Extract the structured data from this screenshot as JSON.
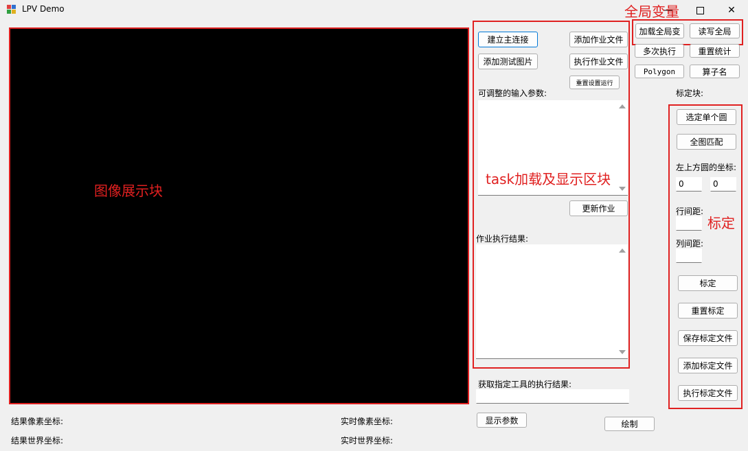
{
  "window": {
    "title": "LPV Demo",
    "minimize_icon": "minimize-icon",
    "maximize_icon": "maximize-icon",
    "close_icon": "close-icon"
  },
  "annotations": {
    "image_area": "图像展示块",
    "task_area": "task加载及显示区块",
    "global_vars": "全局变量",
    "calibration": "标定",
    "color": "#e02020"
  },
  "task_panel": {
    "connect_label": "建立主连接",
    "add_job_label": "添加作业文件",
    "add_test_image_label": "添加测试图片",
    "run_job_label": "执行作业文件",
    "reset_run_label": "重置设置运行",
    "params_label": "可调整的输入参数:",
    "update_job_label": "更新作业",
    "results_label": "作业执行结果:",
    "tool_result_label": "获取指定工具的执行结果:",
    "tool_result_value": "",
    "show_params_label": "显示参数",
    "draw_label": "绘制"
  },
  "global_panel": {
    "load_global_label": "加载全局变",
    "rw_global_label": "读写全局",
    "multi_run_label": "多次执行",
    "reset_stats_label": "重置统计",
    "polygon_label": "Polygon",
    "operator_name_label": "算子名",
    "calib_block_label": "标定块:"
  },
  "calib_panel": {
    "select_circle_label": "选定单个圆",
    "full_match_label": "全图匹配",
    "top_left_label": "左上方圆的坐标:",
    "coord_x_value": "0",
    "coord_y_value": "0",
    "row_spacing_label": "行间距:",
    "row_spacing_value": "",
    "col_spacing_label": "列间距:",
    "col_spacing_value": "",
    "calibrate_label": "标定",
    "reset_calib_label": "重置标定",
    "save_calib_label": "保存标定文件",
    "add_calib_label": "添加标定文件",
    "run_calib_label": "执行标定文件"
  },
  "status": {
    "result_pixel_label": "结果像素坐标:",
    "result_world_label": "结果世界坐标:",
    "realtime_pixel_label": "实时像素坐标:",
    "realtime_world_label": "实时世界坐标:"
  }
}
